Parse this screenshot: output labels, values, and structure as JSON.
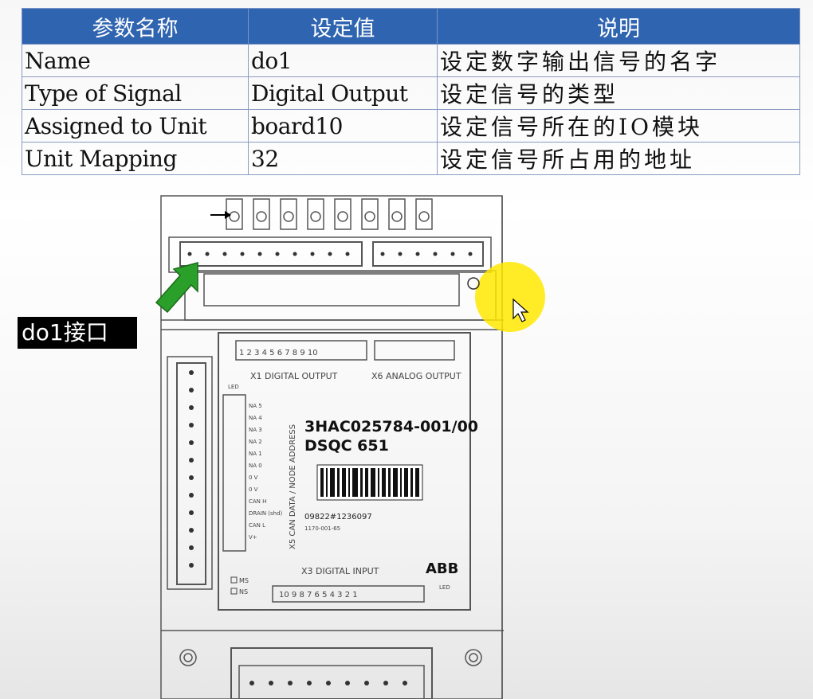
{
  "table": {
    "headers": [
      "参数名称",
      "设定值",
      "说明"
    ],
    "rows": [
      {
        "name": "Name",
        "value": "do1",
        "desc": "设定数字输出信号的名字"
      },
      {
        "name": "Type of Signal",
        "value": "Digital Output",
        "desc": "设定信号的类型"
      },
      {
        "name": "Assigned to Unit",
        "value": "board10",
        "desc": "设定信号所在的IO模块"
      },
      {
        "name": "Unit Mapping",
        "value": "32",
        "desc": "设定信号所占用的地址"
      }
    ]
  },
  "callout": {
    "label": "do1接口",
    "arrow_color": "#2aa02a"
  },
  "device": {
    "x1_label": "X1 DIGITAL OUTPUT",
    "x1_pins": "1 2 3 4 5 6 7 8 9 10",
    "x6_label": "X6 ANALOG OUTPUT",
    "led_label": "LED",
    "x5_label": "X5 CAN DATA / NODE ADDRESS",
    "x5_pins": [
      "NA 5",
      "NA 4",
      "NA 3",
      "NA 2",
      "NA 1",
      "NA 0",
      "0 V",
      "0 V",
      "CAN H",
      "DRAIN (shd)",
      "CAN L",
      "V+"
    ],
    "part_number": "3HAC025784-001/00",
    "model": "DSQC 651",
    "serial": "09822#1236097",
    "serial_small": "1170-001-65",
    "x3_label": "X3 DIGITAL INPUT",
    "x3_pins": "10 9 8 7 6 5 4 3 2 1",
    "brand": "ABB",
    "status_ms": "MS",
    "status_ns": "NS",
    "led_bottom": "LED"
  },
  "cursor_highlight_color": "#ffe800"
}
